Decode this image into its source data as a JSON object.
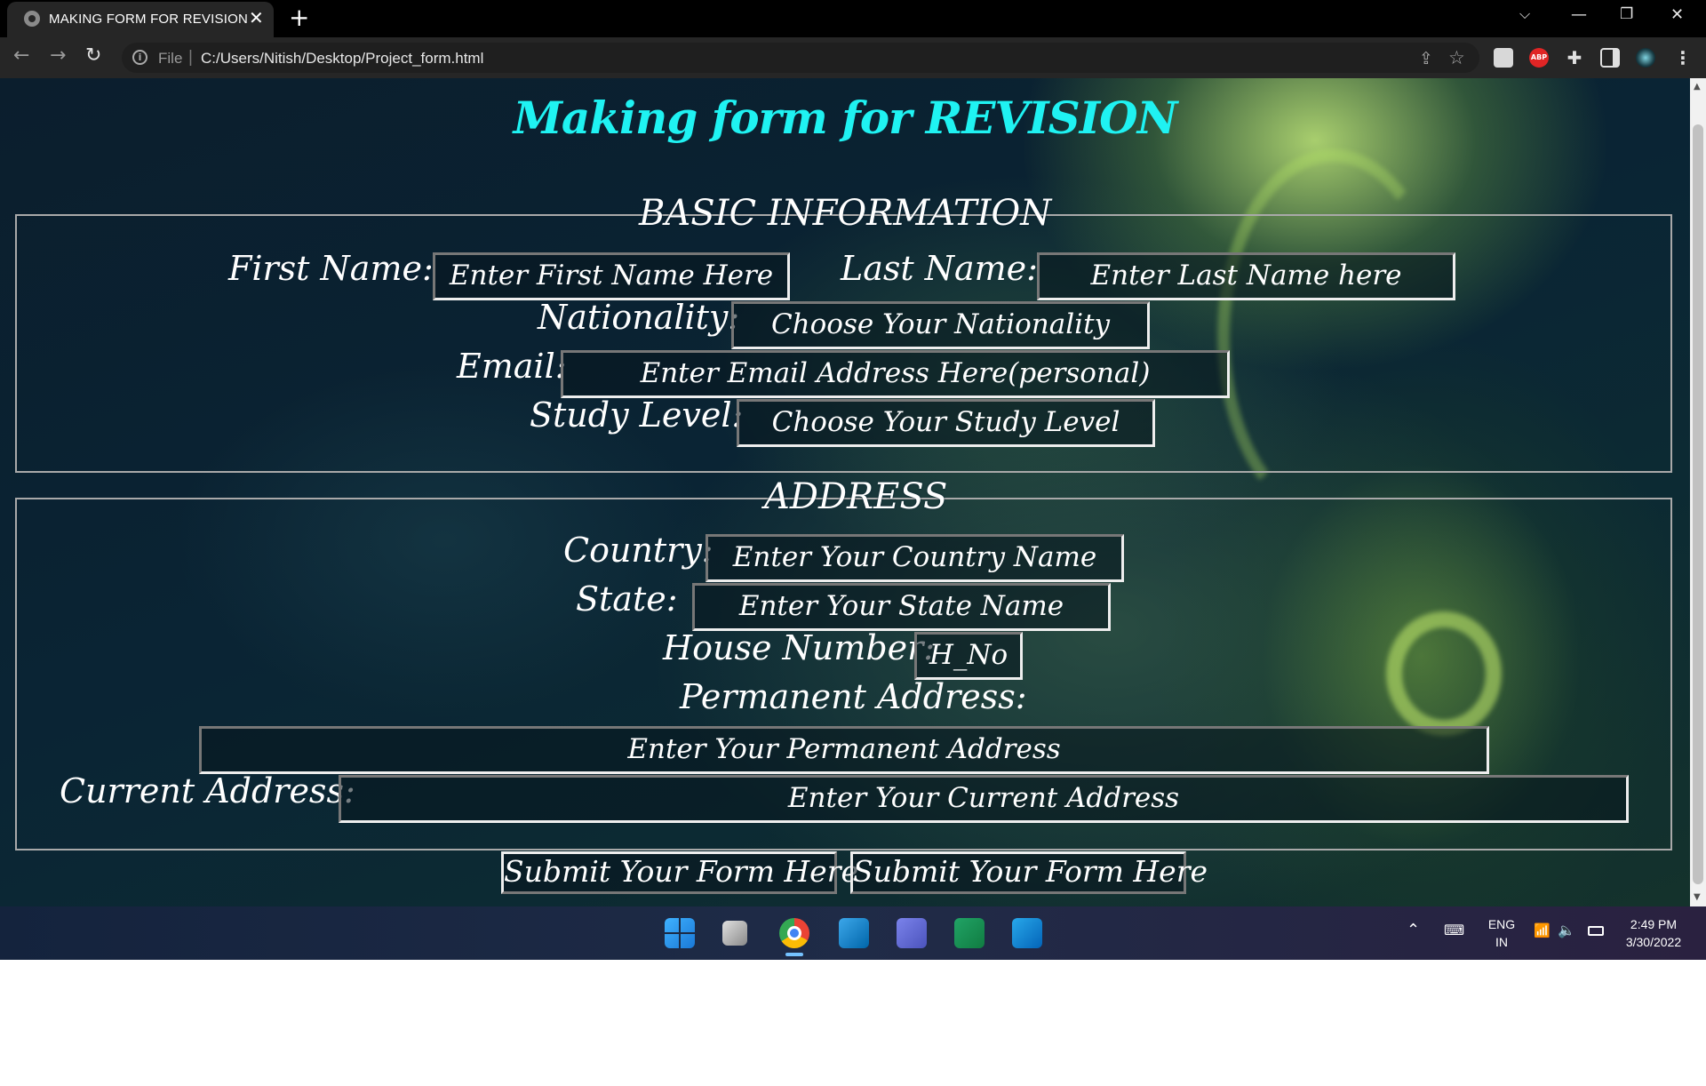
{
  "browser": {
    "tab_title": "MAKING FORM FOR REVISION",
    "tab_close": "✕",
    "new_tab": "+",
    "url_scheme_label": "File",
    "url_separator": "|",
    "url": "C:/Users/Nitish/Desktop/Project_form.html"
  },
  "page": {
    "title": "Making form for REVISION",
    "basic_section": {
      "legend": "BASIC INFORMATION",
      "first_name_label": "First Name:",
      "first_name_placeholder": "Enter First Name Here",
      "last_name_label": "Last Name:",
      "last_name_placeholder": "Enter Last Name here",
      "nationality_label": "Nationality:",
      "nationality_placeholder": "Choose Your Nationality",
      "email_label": "Email:",
      "email_placeholder": "Enter Email Address Here(personal)",
      "study_level_label": "Study Level:",
      "study_level_placeholder": "Choose Your Study Level"
    },
    "address_section": {
      "legend": "ADDRESS",
      "country_label": "Country:",
      "country_placeholder": "Enter Your Country Name",
      "state_label": "State:",
      "state_placeholder": "Enter Your State Name",
      "house_number_label": "House Number:",
      "house_number_placeholder": "H_No",
      "permanent_address_label": "Permanent Address:",
      "permanent_address_placeholder": "Enter Your Permanent Address",
      "current_address_label": "Current Address:",
      "current_address_placeholder": "Enter Your Current Address"
    },
    "buttons": {
      "submit_1": "Submit Your Form Here",
      "submit_2": "Submit Your Form Here"
    }
  },
  "taskbar": {
    "language": "ENG",
    "region": "IN",
    "time": "2:49 PM",
    "date": "3/30/2022"
  },
  "colors": {
    "title_cyan": "#1ff2f2",
    "border_gray": "#a9a9a9",
    "taskbar_bg": "#1c2a44"
  }
}
